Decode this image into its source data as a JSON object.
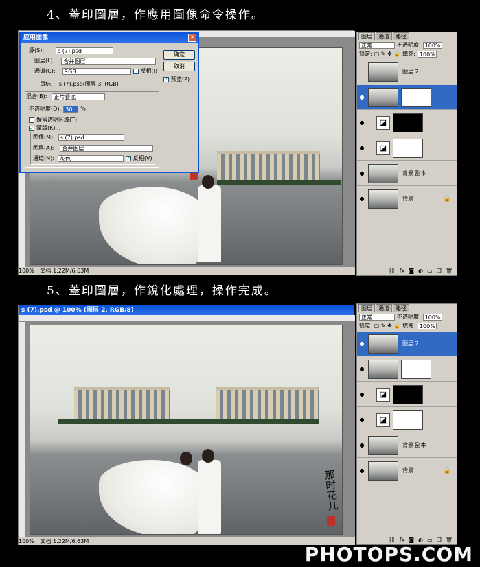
{
  "steps": {
    "step4": "4、蓋印圖層，作應用圖像命令操作。",
    "step5": "5、蓋印圖層，作銳化處理，操作完成。"
  },
  "top": {
    "status": {
      "zoom": "100%",
      "doc": "文档:1.22M/6.63M"
    },
    "dialog": {
      "title": "应用图像",
      "source_label": "源(S):",
      "source_value": "s (7).psd",
      "layer_label": "图层(L):",
      "layer_value": "合并图层",
      "channel_label": "通道(C):",
      "channel_value": "RGB",
      "invert_label": "反相(I)",
      "target_label": "目标:",
      "target_value": "s (7).psd(图层 3, RGB)",
      "blending_label": "混合(B):",
      "blending_value": "正片叠底",
      "opacity_label": "不透明度(O):",
      "opacity_value": "30",
      "opacity_unit": "%",
      "preserve_label": "保留透明区域(T)",
      "mask_label": "蒙版(K)...",
      "image_label": "图像(M):",
      "image_value": "s (7).psd",
      "mask_layer_label": "图层(A):",
      "mask_layer_value": "合并图层",
      "mask_channel_label": "通道(N):",
      "mask_channel_value": "灰色",
      "mask_invert_label": "反相(V)",
      "ok": "确定",
      "cancel": "取消",
      "preview": "预览(P)"
    },
    "panel": {
      "tabs": [
        "图层",
        "通道",
        "路径"
      ],
      "blend_mode": "正常",
      "opacity_label": "不透明度:",
      "opacity_value": "100%",
      "lock_label": "锁定:",
      "fill_label": "填充:",
      "fill_value": "100%",
      "layers": [
        {
          "name": "图层 2",
          "visible": false,
          "kind": "pixel"
        },
        {
          "name": "",
          "visible": true,
          "kind": "pixel-mask",
          "selected": true
        },
        {
          "name": "",
          "visible": true,
          "kind": "adjust-black"
        },
        {
          "name": "",
          "visible": true,
          "kind": "adjust-white"
        },
        {
          "name": "背景 副本",
          "visible": true,
          "kind": "pixel"
        },
        {
          "name": "背景",
          "visible": true,
          "kind": "background"
        }
      ]
    }
  },
  "bottom": {
    "title": "s (7).psd @ 100% (图层 2, RGB/8)",
    "status": {
      "zoom": "100%",
      "doc": "文档:1.22M/6.63M"
    },
    "panel": {
      "tabs": [
        "图层",
        "通道",
        "路径"
      ],
      "blend_mode": "正常",
      "opacity_label": "不透明度:",
      "opacity_value": "100%",
      "lock_label": "锁定:",
      "fill_label": "填充:",
      "fill_value": "100%",
      "layers": [
        {
          "name": "图层 2",
          "visible": true,
          "kind": "pixel",
          "selected": true
        },
        {
          "name": "",
          "visible": true,
          "kind": "pixel-mask"
        },
        {
          "name": "",
          "visible": true,
          "kind": "adjust-black"
        },
        {
          "name": "",
          "visible": true,
          "kind": "adjust-white"
        },
        {
          "name": "背景 副本",
          "visible": true,
          "kind": "pixel"
        },
        {
          "name": "背景",
          "visible": true,
          "kind": "background"
        }
      ]
    }
  },
  "calligraphy": "那时花儿",
  "watermark": "PHOTOPS.COM"
}
